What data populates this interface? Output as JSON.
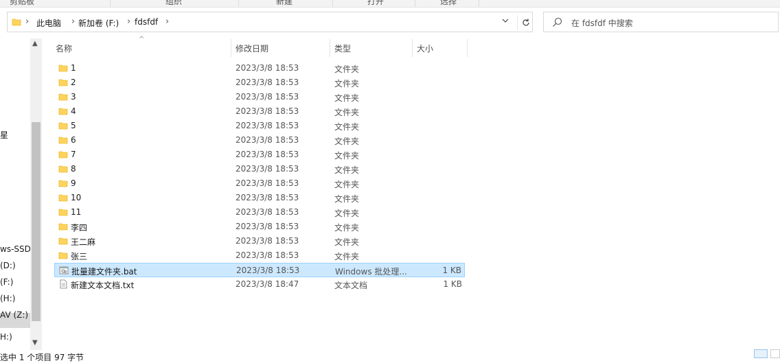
{
  "ribbon": {
    "groups": [
      "剪贴板",
      "组织",
      "新建",
      "打开",
      "选择"
    ]
  },
  "address": {
    "crumbs": [
      "此电脑",
      "新加卷 (F:)",
      "fdsfdf"
    ]
  },
  "search": {
    "placeholder": "在 fdsfdf 中搜索"
  },
  "nav": {
    "items": [
      "星",
      "ws-SSD",
      "(D:)",
      "(F:)",
      "(H:)",
      "AV (Z:)",
      "H:)"
    ]
  },
  "columns": {
    "name": "名称",
    "date": "修改日期",
    "type": "类型",
    "size": "大小"
  },
  "files": [
    {
      "name": "1",
      "date": "2023/3/8 18:53",
      "type": "文件夹",
      "size": "",
      "icon": "folder-icon"
    },
    {
      "name": "2",
      "date": "2023/3/8 18:53",
      "type": "文件夹",
      "size": "",
      "icon": "folder-icon"
    },
    {
      "name": "3",
      "date": "2023/3/8 18:53",
      "type": "文件夹",
      "size": "",
      "icon": "folder-icon"
    },
    {
      "name": "4",
      "date": "2023/3/8 18:53",
      "type": "文件夹",
      "size": "",
      "icon": "folder-icon"
    },
    {
      "name": "5",
      "date": "2023/3/8 18:53",
      "type": "文件夹",
      "size": "",
      "icon": "folder-icon"
    },
    {
      "name": "6",
      "date": "2023/3/8 18:53",
      "type": "文件夹",
      "size": "",
      "icon": "folder-icon"
    },
    {
      "name": "7",
      "date": "2023/3/8 18:53",
      "type": "文件夹",
      "size": "",
      "icon": "folder-icon"
    },
    {
      "name": "8",
      "date": "2023/3/8 18:53",
      "type": "文件夹",
      "size": "",
      "icon": "folder-icon"
    },
    {
      "name": "9",
      "date": "2023/3/8 18:53",
      "type": "文件夹",
      "size": "",
      "icon": "folder-icon"
    },
    {
      "name": "10",
      "date": "2023/3/8 18:53",
      "type": "文件夹",
      "size": "",
      "icon": "folder-icon"
    },
    {
      "name": "11",
      "date": "2023/3/8 18:53",
      "type": "文件夹",
      "size": "",
      "icon": "folder-icon"
    },
    {
      "name": "李四",
      "date": "2023/3/8 18:53",
      "type": "文件夹",
      "size": "",
      "icon": "folder-icon"
    },
    {
      "name": "王二麻",
      "date": "2023/3/8 18:53",
      "type": "文件夹",
      "size": "",
      "icon": "folder-icon"
    },
    {
      "name": "张三",
      "date": "2023/3/8 18:53",
      "type": "文件夹",
      "size": "",
      "icon": "folder-icon"
    },
    {
      "name": "批量建文件夹.bat",
      "date": "2023/3/8 18:53",
      "type": "Windows 批处理...",
      "size": "1 KB",
      "icon": "batch-file-icon",
      "selected": true
    },
    {
      "name": "新建文本文档.txt",
      "date": "2023/3/8 18:47",
      "type": "文本文档",
      "size": "1 KB",
      "icon": "text-file-icon"
    }
  ],
  "status": {
    "text": "选中 1 个项目  97 字节"
  },
  "colors": {
    "selection_bg": "#cce8ff",
    "selection_border": "#99d1ff",
    "folder_yellow": "#ffd45e"
  }
}
